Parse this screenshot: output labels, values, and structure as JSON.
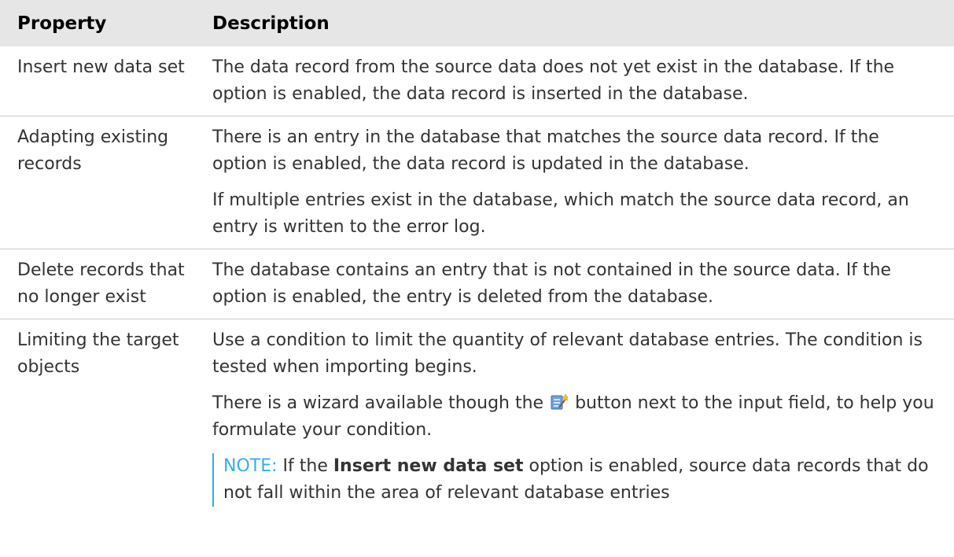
{
  "table": {
    "header": {
      "property": "Property",
      "description": "Description"
    },
    "rows": [
      {
        "property": "Insert new data set",
        "paragraphs": [
          "The data record from the source data does not yet exist in the database. If the option is enabled, the data record is inserted in the database."
        ]
      },
      {
        "property": "Adapting existing records",
        "paragraphs": [
          "There is an entry in the database that matches the source data record. If the option is enabled, the data record is updated in the database.",
          "If multiple entries exist in the database, which match the source data record, an entry is written to the error log."
        ]
      },
      {
        "property": "Delete records that no longer exist",
        "paragraphs": [
          "The database contains an entry that is not contained in the source data. If the option is enabled, the entry is deleted from the database."
        ]
      },
      {
        "property": "Limiting the target objects",
        "paragraphs": [
          "Use a condition to limit the quantity of relevant database entries. The condition is tested when importing begins."
        ],
        "wizard_text_before": "There is a wizard available though the",
        "wizard_icon": "wizard-icon",
        "wizard_text_after": "button next to the input field, to help you formulate your condition.",
        "note": {
          "label": "NOTE:",
          "text_before": "If the",
          "bold": "Insert new data set",
          "text_after": "option is enabled, source data records that do not fall within the area of relevant database entries"
        }
      }
    ]
  },
  "colors": {
    "header_bg": "#e6e6e6",
    "note_accent": "#35aee8",
    "text": "#333333"
  }
}
